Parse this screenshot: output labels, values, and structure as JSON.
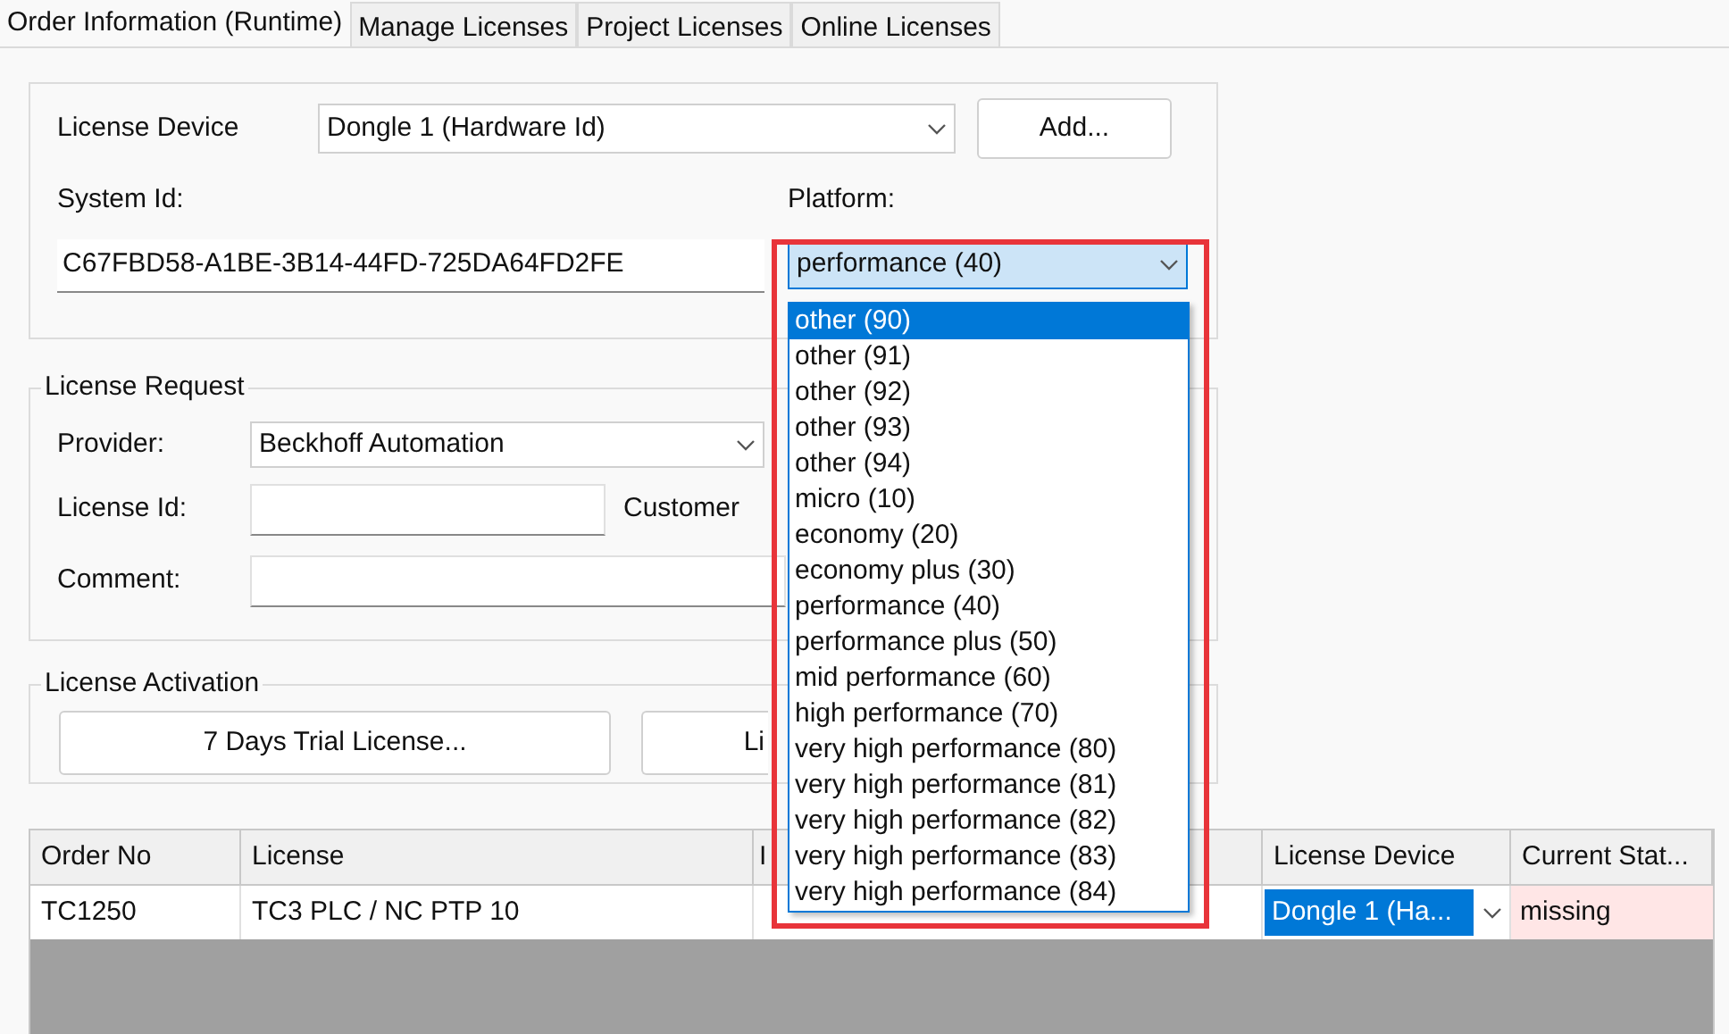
{
  "tabs": [
    {
      "label": "Order Information (Runtime)",
      "selected": true
    },
    {
      "label": "Manage Licenses",
      "selected": false
    },
    {
      "label": "Project Licenses",
      "selected": false
    },
    {
      "label": "Online Licenses",
      "selected": false
    }
  ],
  "device_group": {
    "license_device_label": "License Device",
    "license_device": "Dongle 1 (Hardware Id)",
    "add_button": "Add...",
    "system_id_label": "System Id:",
    "system_id": "C67FBD58-A1BE-3B14-44FD-725DA64FD2FE",
    "platform_label": "Platform:",
    "platform": "performance (40)"
  },
  "platform_options": [
    {
      "label": "other (90)",
      "selected": true
    },
    {
      "label": "other (91)",
      "selected": false
    },
    {
      "label": "other (92)",
      "selected": false
    },
    {
      "label": "other (93)",
      "selected": false
    },
    {
      "label": "other (94)",
      "selected": false
    },
    {
      "label": "micro (10)",
      "selected": false
    },
    {
      "label": "economy (20)",
      "selected": false
    },
    {
      "label": "economy plus (30)",
      "selected": false
    },
    {
      "label": "performance (40)",
      "selected": false
    },
    {
      "label": "performance plus (50)",
      "selected": false
    },
    {
      "label": "mid performance (60)",
      "selected": false
    },
    {
      "label": "high performance (70)",
      "selected": false
    },
    {
      "label": "very high performance (80)",
      "selected": false
    },
    {
      "label": "very high performance (81)",
      "selected": false
    },
    {
      "label": "very high performance (82)",
      "selected": false
    },
    {
      "label": "very high performance (83)",
      "selected": false
    },
    {
      "label": "very high performance (84)",
      "selected": false
    }
  ],
  "license_request": {
    "title": "License Request",
    "provider_label": "Provider:",
    "provider": "Beckhoff Automation",
    "license_id_label": "License Id:",
    "customer_label": "Customer",
    "comment_label": "Comment:"
  },
  "license_activation": {
    "title": "License Activation",
    "buttons": [
      "7 Days Trial License...",
      "Li"
    ]
  },
  "table": {
    "columns": [
      "Order No",
      "License",
      "I",
      "License Device",
      "Current Stat..."
    ],
    "rows": [
      {
        "order_no": "TC1250",
        "license": "TC3 PLC / NC PTP 10",
        "license_device": "Dongle 1 (Ha...",
        "device_selected": true,
        "current_status": "missing"
      }
    ]
  }
}
